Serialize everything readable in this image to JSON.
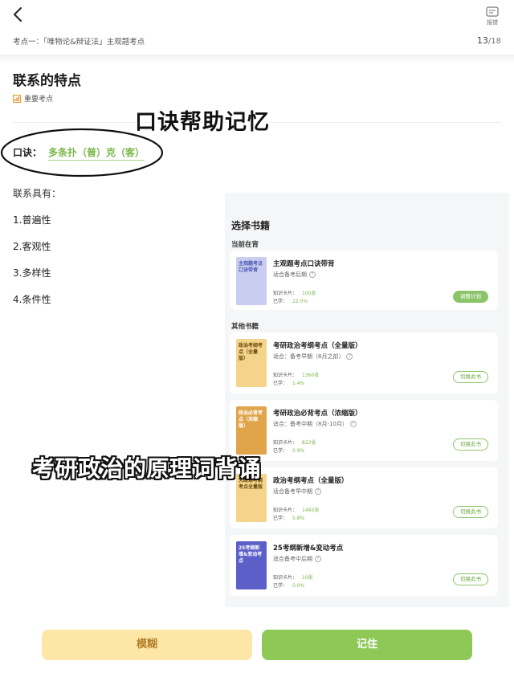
{
  "header": {
    "report_label": "报错",
    "breadcrumb": "考点一：「唯物论&辩证法」主观题考点",
    "page_current": "13",
    "page_total": "/18"
  },
  "content": {
    "title": "联系的特点",
    "tag": "重要考点",
    "overlay_tip": "口诀帮助记忆",
    "mnemonic_label": "口诀：",
    "mnemonic_value": "多条扑（普）克（客）",
    "intro": "联系具有：",
    "properties": [
      "1.普遍性",
      "2.客观性",
      "3.多样性",
      "4.条件性"
    ]
  },
  "panel": {
    "title": "选择书籍",
    "current_section": "当前在背",
    "other_section": "其他书籍",
    "current_book": {
      "cover_text": "主观题考点口诀带背",
      "title": "主观题考点口诀带背",
      "suitable": "适合备考后期",
      "cards_label": "知识卡片：",
      "cards_value": "100张",
      "learned_label": "已学：",
      "learned_value": "22.0%",
      "button": "调整计划"
    },
    "books": [
      {
        "cover_text": "政治考纲考点（全量版）",
        "title": "考研政治考纲考点（全量版）",
        "suitable": "适合：备考早期（8月之前）",
        "cards_label": "知识卡片：",
        "cards_value": "1360张",
        "learned_label": "已学：",
        "learned_value": "1.4%",
        "button": "切换此书"
      },
      {
        "cover_text": "政治必背考点（浓缩版）",
        "title": "考研政治必背考点（浓缩版）",
        "suitable": "适合：备考中期（8月-10月）",
        "cards_label": "知识卡片：",
        "cards_value": "822张",
        "learned_label": "已学：",
        "learned_value": "0.9%",
        "button": "切换此书"
      },
      {
        "cover_text": "大政治考纲考点全量版",
        "title": "政治考纲考点（全量版）",
        "suitable": "适合备考早中期",
        "cards_label": "知识卡片：",
        "cards_value": "1493张",
        "learned_label": "已学：",
        "learned_value": "5.8%",
        "button": "切换此书"
      },
      {
        "cover_text": "25考纲新增&变动考点",
        "title": "25考纲新增&变动考点",
        "suitable": "适合备考中后期",
        "cards_label": "知识卡片：",
        "cards_value": "10张",
        "learned_label": "已学：",
        "learned_value": "0.0%",
        "button": "切换此书"
      }
    ]
  },
  "overlay_caption": "考研政治的原理词背诵",
  "bottom": {
    "fuzzy": "模糊",
    "remember": "记住"
  },
  "colors": {
    "accent_green": "#8ec957",
    "fuzzy_bg": "#fde6a6",
    "mnemonic_text": "#7ab648"
  }
}
